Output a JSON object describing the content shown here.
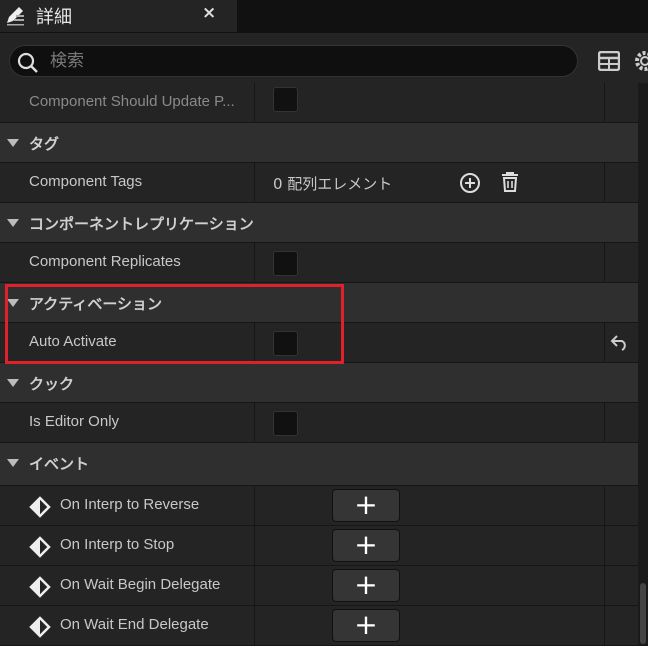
{
  "tab": {
    "title": "詳細",
    "close": "×",
    "icon": "edit-icon"
  },
  "search": {
    "placeholder": "検索"
  },
  "rows": {
    "should_update": "Component Should Update P...",
    "cat_tags": "タグ",
    "component_tags": "Component Tags",
    "component_tags_value": "0 配列エレメント",
    "cat_replication": "コンポーネントレプリケーション",
    "component_replicates": "Component Replicates",
    "cat_activation": "アクティベーション",
    "auto_activate": "Auto Activate",
    "cat_cook": "クック",
    "is_editor_only": "Is Editor Only",
    "cat_events": "イベント"
  },
  "events": [
    "On Interp to Reverse",
    "On Interp to Stop",
    "On Wait Begin Delegate",
    "On Wait End Delegate"
  ],
  "add_label": "+",
  "colors": {
    "highlight": "#e0202a",
    "panel": "#242424",
    "category": "#2f2f2f"
  }
}
